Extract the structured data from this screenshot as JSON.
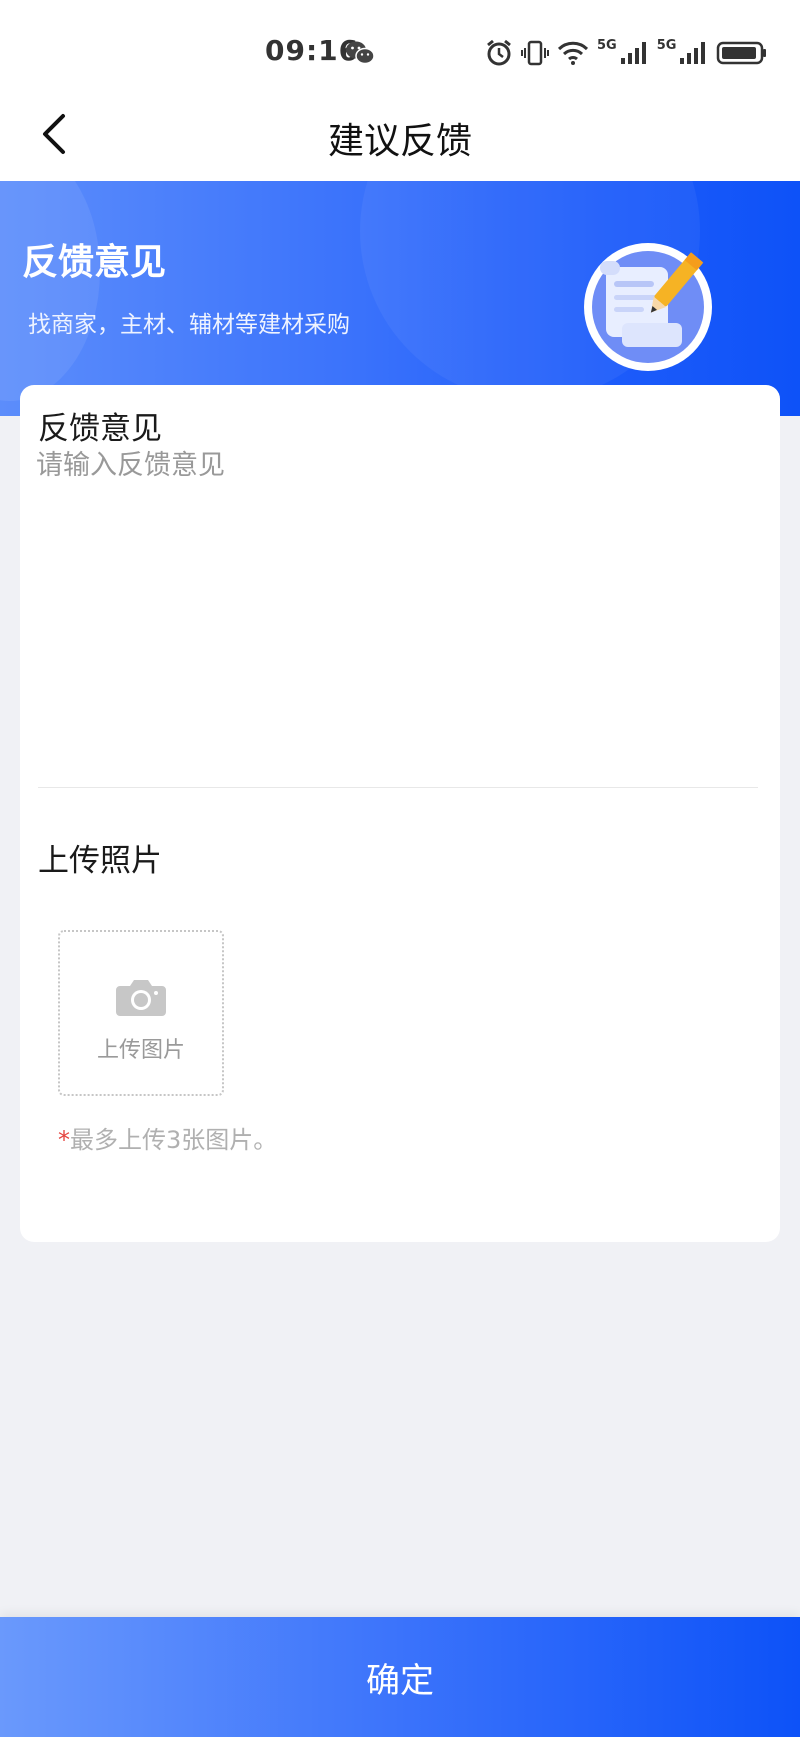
{
  "status_bar": {
    "time": "09:16",
    "network_1": "5G",
    "network_2": "5G"
  },
  "nav": {
    "title": "建议反馈"
  },
  "banner": {
    "title": "反馈意见",
    "subtitle": "找商家，主材、辅材等建材采购"
  },
  "form": {
    "feedback_label": "反馈意见",
    "feedback_placeholder": "请输入反馈意见",
    "upload_label": "上传照片",
    "upload_button_text": "上传图片",
    "upload_hint_star": "*",
    "upload_hint": "最多上传3张图片。"
  },
  "footer": {
    "confirm_label": "确定"
  },
  "colors": {
    "primary": "#1e5cfa",
    "banner_start": "#5c8dfb",
    "required_star": "#e5443f"
  },
  "icons": [
    "wechat-icon",
    "alarm-icon",
    "vibrate-icon",
    "wifi-icon",
    "signal-icon",
    "battery-icon",
    "back-arrow-icon",
    "camera-icon",
    "document-pencil-icon"
  ]
}
